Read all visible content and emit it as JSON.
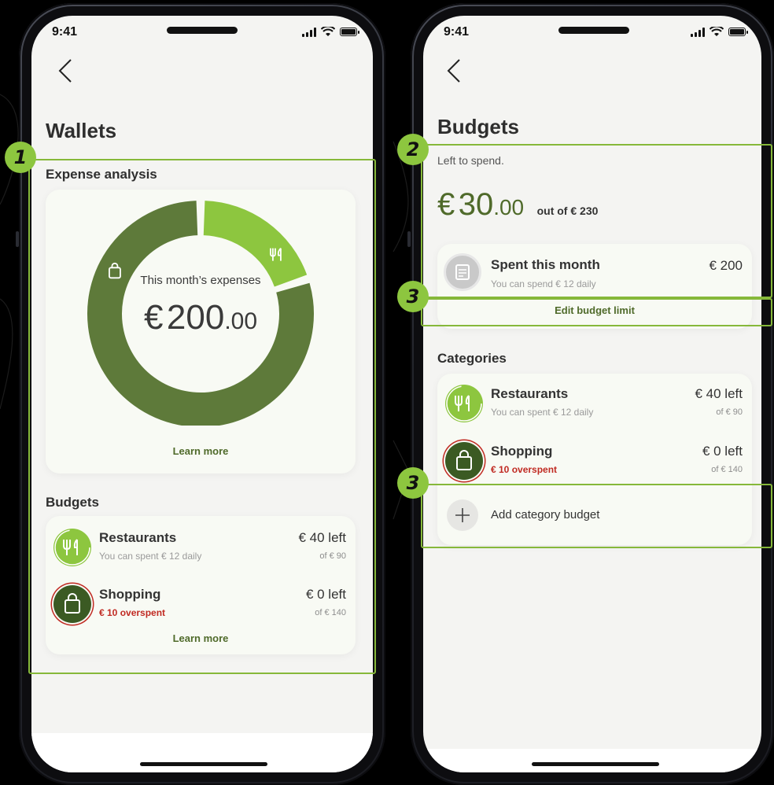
{
  "status": {
    "time": "9:41"
  },
  "annotations": {
    "badge1": "1",
    "badge2": "2",
    "badge3a": "3",
    "badge3b": "3"
  },
  "wallets": {
    "title": "Wallets",
    "expense_section": "Expense analysis",
    "donut_label": "This month’s expenses",
    "donut_currency": "€",
    "donut_amount_int": "200",
    "donut_amount_dec": ".00",
    "learn_more_1": "Learn more",
    "budgets_section": "Budgets",
    "budgets": [
      {
        "name": "Restaurants",
        "sub": "You can spent  € 12 daily",
        "left": "€ 40 left",
        "of": "of € 90",
        "icon": "fork-knife-icon"
      },
      {
        "name": "Shopping",
        "sub": "€ 10 overspent",
        "left": "€ 0 left",
        "of": "of € 140",
        "icon": "shopping-bag-icon"
      }
    ],
    "learn_more_2": "Learn more",
    "chart_data": {
      "type": "pie",
      "categories": [
        "Restaurants",
        "Shopping"
      ],
      "values": [
        40,
        160
      ]
    }
  },
  "budgets_screen": {
    "title": "Budgets",
    "left_to_spend": "Left to spend.",
    "big_currency": "€",
    "big_int": "30",
    "big_dec": ".00",
    "out_of": "out of € 230",
    "spent_label": "Spent this month",
    "spent_amount": "€ 200",
    "spent_sub": "You can spend  € 12 daily",
    "edit_limit": "Edit budget limit",
    "categories_title": "Categories",
    "categories": [
      {
        "name": "Restaurants",
        "sub": "You can spent  € 12 daily",
        "left": "€ 40 left",
        "of": "of € 90",
        "icon": "fork-knife-icon"
      },
      {
        "name": "Shopping",
        "sub": "€ 10 overspent",
        "left": "€ 0 left",
        "of": "of € 140",
        "icon": "shopping-bag-icon"
      }
    ],
    "add_category": "Add category budget"
  },
  "colors": {
    "primary_dark": "#5e7a3a",
    "primary_light": "#8dc63f",
    "shopping_dark": "#3b5a23",
    "overspent": "#c02a22",
    "annotation": "#86b83a"
  }
}
